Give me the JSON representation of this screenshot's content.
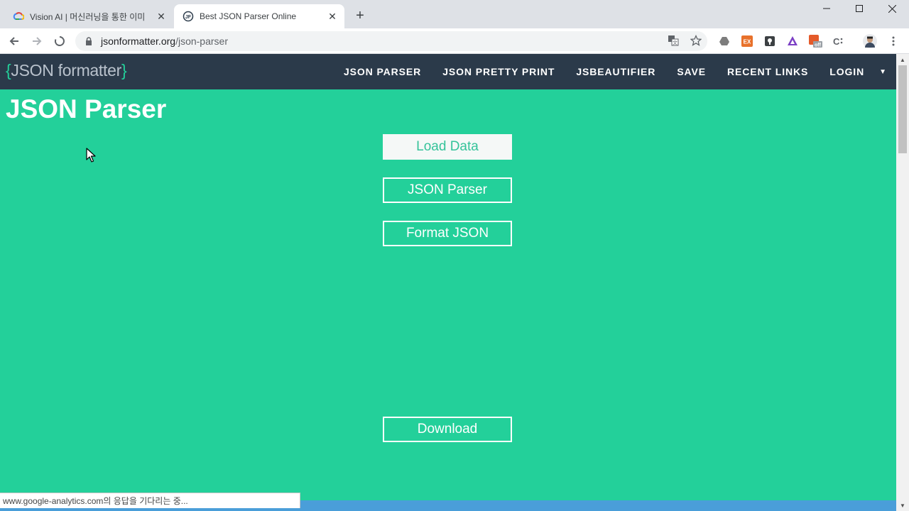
{
  "browser": {
    "tabs": [
      {
        "title": "Vision AI | 머신러닝을 통한 이미",
        "active": false,
        "icon": "google-cloud-icon"
      },
      {
        "title": "Best JSON Parser Online",
        "active": true,
        "icon": "jsonformatter-favicon"
      }
    ],
    "url_host": "jsonformatter.org",
    "url_path": "/json-parser",
    "status_text": "www.google-analytics.com의 응답을 기다리는 중..."
  },
  "site": {
    "logo_open": "{",
    "logo_text": "JSON formatter",
    "logo_close": "}",
    "nav": [
      "JSON PARSER",
      "JSON PRETTY PRINT",
      "JSBEAUTIFIER",
      "SAVE",
      "RECENT LINKS",
      "LOGIN"
    ]
  },
  "main": {
    "title": "JSON Parser",
    "load_data_label": "Load Data",
    "json_parser_label": "JSON Parser",
    "format_json_label": "Format JSON",
    "download_label": "Download"
  },
  "colors": {
    "page_bg": "#23d09a",
    "nav_bg": "#2b3a4a",
    "load_bar": "#4a9ed9"
  }
}
